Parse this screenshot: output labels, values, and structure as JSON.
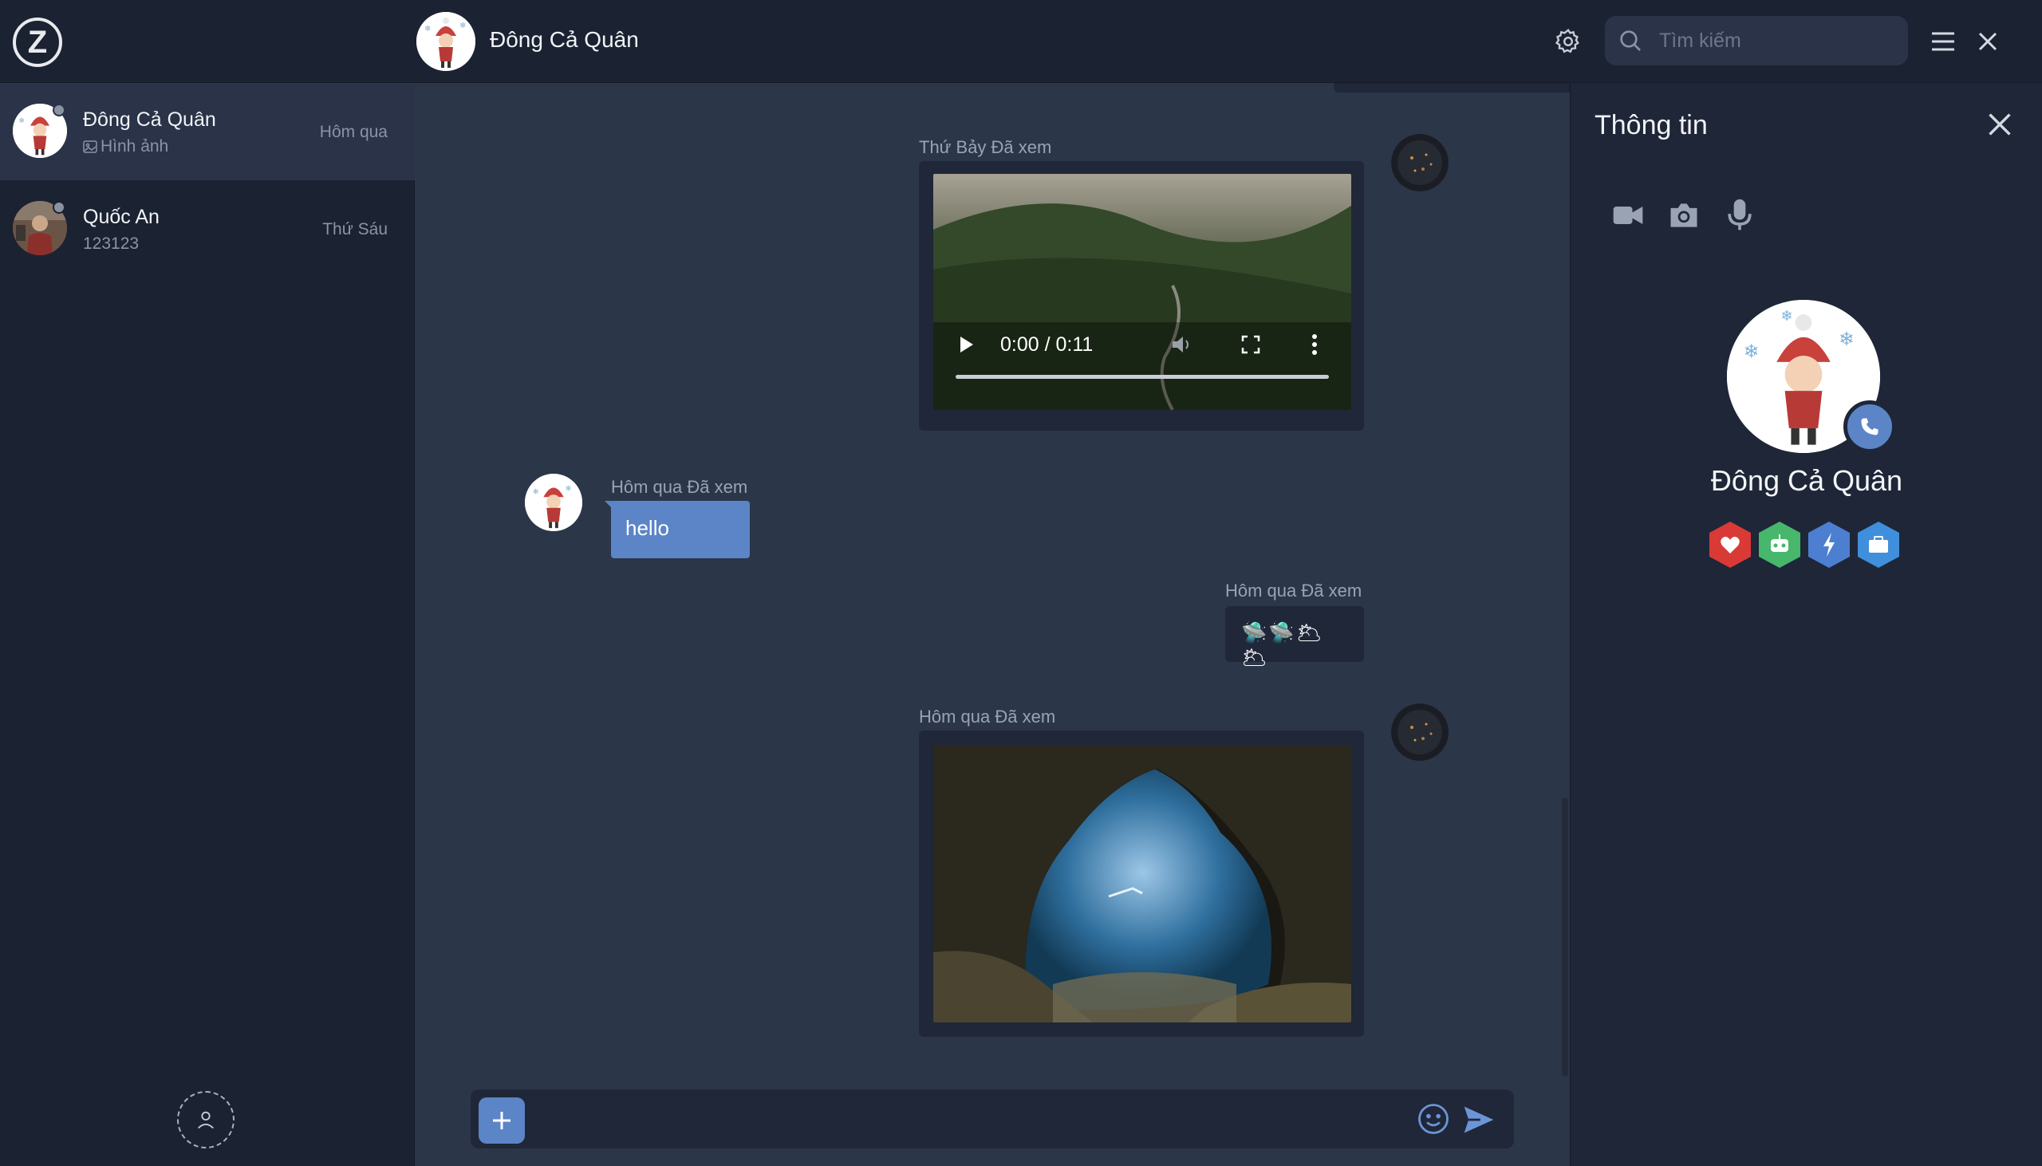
{
  "app": {
    "logo_letter": "Z"
  },
  "header": {
    "contact_name": "Đông Cả Quân",
    "search_placeholder": "Tìm kiếm"
  },
  "sidebar": {
    "conversations": [
      {
        "name": "Đông Cả Quân",
        "preview": "Hình ảnh",
        "time": "Hôm qua",
        "active": true
      },
      {
        "name": "Quốc An",
        "preview": "123123",
        "time": "Thứ Sáu",
        "active": false
      }
    ]
  },
  "messages": {
    "video_meta": "Thứ Bảy Đã xem",
    "video_time": "0:00 / 0:11",
    "hello_meta": "Hôm qua Đã xem",
    "hello_text": "hello",
    "emoji_meta": "Hôm qua Đã xem",
    "emoji_text": "🛸🛸🌥🌥",
    "photo_meta": "Hôm qua Đã xem"
  },
  "composer": {
    "value": ""
  },
  "info_panel": {
    "title": "Thông tin",
    "name": "Đông Cả Quân",
    "badges": [
      {
        "icon": "heart-icon",
        "color": "#d93a35"
      },
      {
        "icon": "robot-icon",
        "color": "#47b76b"
      },
      {
        "icon": "bolt-icon",
        "color": "#4d7fd0"
      },
      {
        "icon": "briefcase-icon",
        "color": "#3f8fdc"
      }
    ]
  },
  "colors": {
    "accent": "#5b85c6",
    "panel": "#1b2231",
    "chat_bg": "#2c3649"
  }
}
